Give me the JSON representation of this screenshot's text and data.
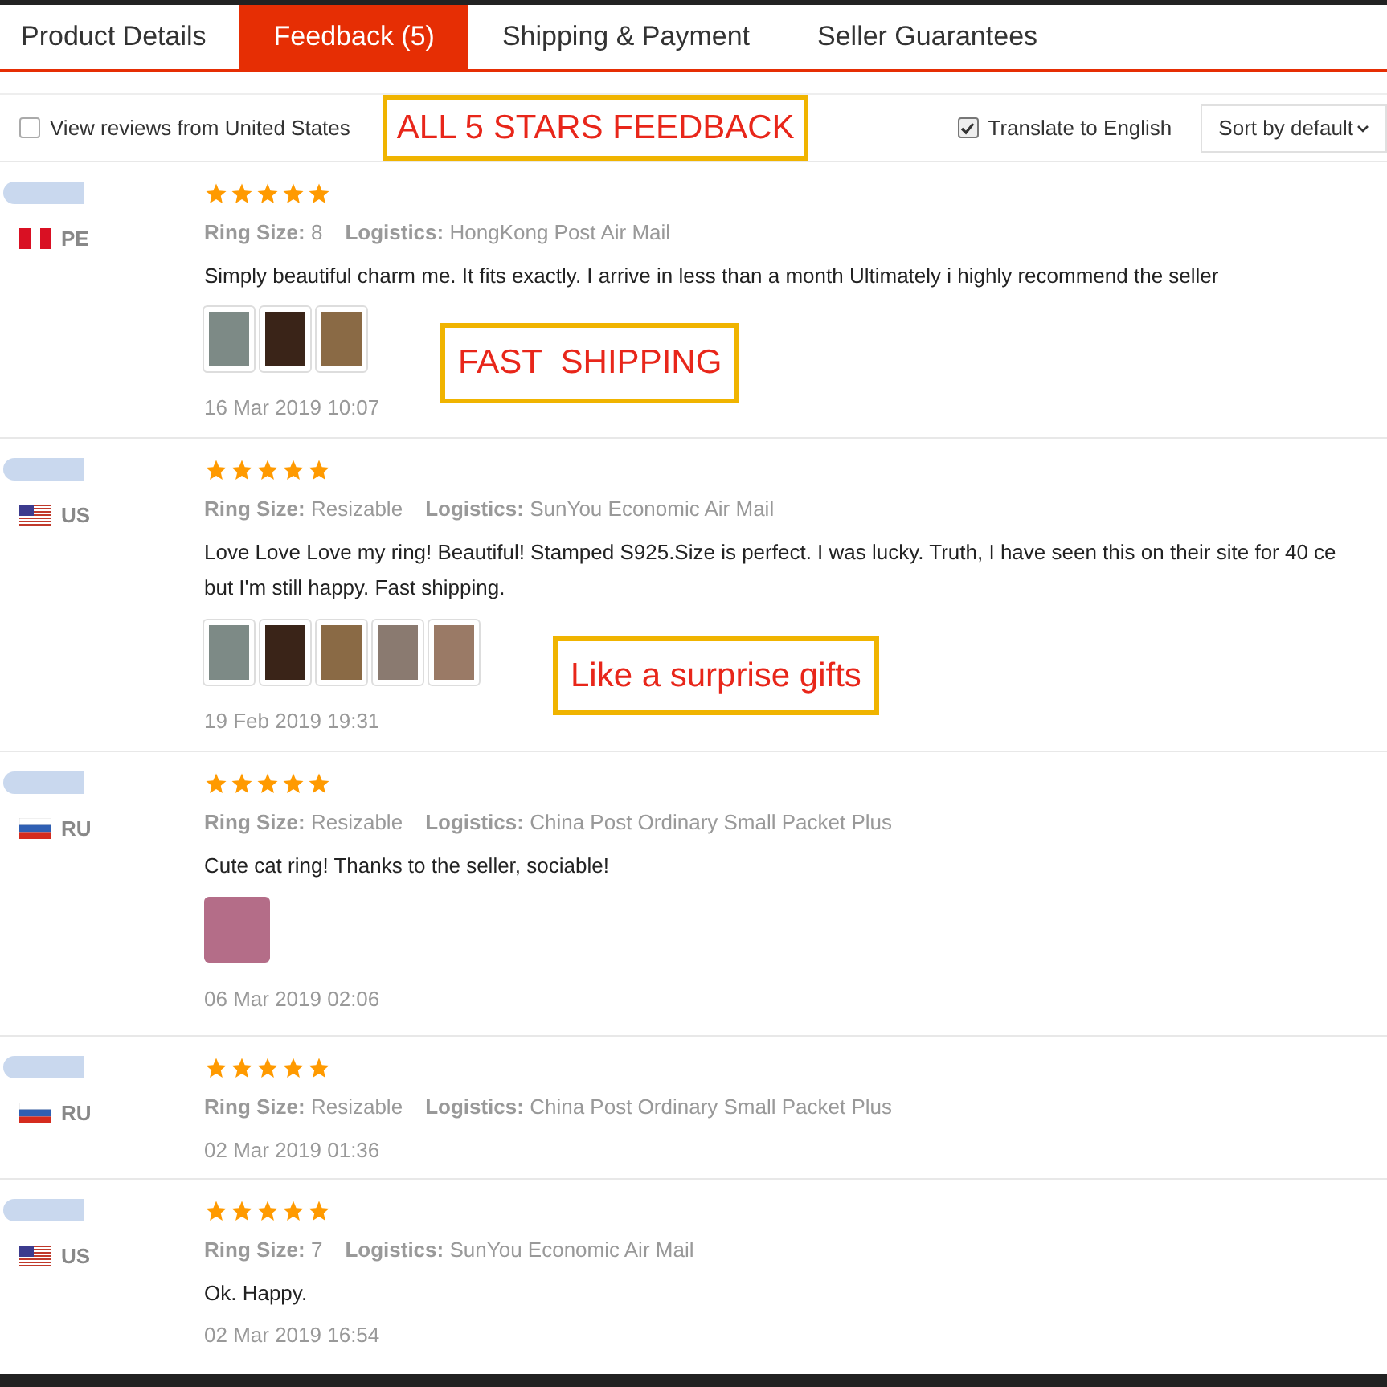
{
  "tabs": [
    {
      "label": "Product Details",
      "selected": false
    },
    {
      "label": "Feedback (5)",
      "selected": true
    },
    {
      "label": "Shipping & Payment",
      "selected": false
    },
    {
      "label": "Seller Guarantees",
      "selected": false
    }
  ],
  "options": {
    "us_only": {
      "label": "View reviews from United States",
      "checked": false
    },
    "banner": "ALL 5 STARS FEEDBACK",
    "translate": {
      "label": "Translate to English",
      "checked": true
    },
    "sort": "Sort by default"
  },
  "reviews": [
    {
      "flag": {
        "kind": "peru"
      },
      "country": "PE",
      "stars": 5,
      "ring_size_label": "Ring Size:",
      "ring_size": "8",
      "logistics_label": "Logistics:",
      "logistics": "HongKong Post Air Mail",
      "text_lines": [
        "Simply beautiful charm me. It fits exactly. I arrive in less than a month Ultimately i highly recommend the seller"
      ],
      "photos": [
        {
          "kind": "photo"
        },
        {
          "kind": "photo"
        },
        {
          "kind": "photo"
        }
      ],
      "callout": "FAST  SHIPPING",
      "date": "16 Mar 2019 10:07"
    },
    {
      "flag": {
        "kind": "usa"
      },
      "country": "US",
      "stars": 5,
      "ring_size_label": "Ring Size:",
      "ring_size": "Resizable",
      "logistics_label": "Logistics:",
      "logistics": "SunYou Economic Air Mail",
      "text_lines": [
        "Love Love Love my ring! Beautiful! Stamped S925.Size is perfect. I was lucky. Truth, I have seen this on their site for 40 ce",
        "but I'm still happy. Fast shipping."
      ],
      "photos": [
        {
          "kind": "photo"
        },
        {
          "kind": "photo"
        },
        {
          "kind": "photo"
        },
        {
          "kind": "photo"
        },
        {
          "kind": "photo"
        }
      ],
      "callout": "Like a surprise gifts",
      "date": "19 Feb 2019 19:31"
    },
    {
      "flag": {
        "kind": "russia"
      },
      "country": "RU",
      "stars": 5,
      "ring_size_label": "Ring Size:",
      "ring_size": "Resizable",
      "logistics_label": "Logistics:",
      "logistics": "China Post Ordinary Small Packet Plus",
      "text_lines": [
        "Cute cat ring! Thanks to the seller, sociable!"
      ],
      "photos": [
        {
          "kind": "photo"
        }
      ],
      "date": "06 Mar 2019 02:06"
    },
    {
      "flag": {
        "kind": "russia"
      },
      "country": "RU",
      "stars": 5,
      "ring_size_label": "Ring Size:",
      "ring_size": "Resizable",
      "logistics_label": "Logistics:",
      "logistics": "China Post Ordinary Small Packet Plus",
      "date": "02 Mar 2019 01:36"
    },
    {
      "flag": {
        "kind": "usa"
      },
      "country": "US",
      "stars": 5,
      "ring_size_label": "Ring Size:",
      "ring_size": "7",
      "logistics_label": "Logistics:",
      "logistics": "SunYou Economic Air Mail",
      "text_lines": [
        "Ok. Happy."
      ],
      "date": "02 Mar 2019 16:54"
    }
  ]
}
